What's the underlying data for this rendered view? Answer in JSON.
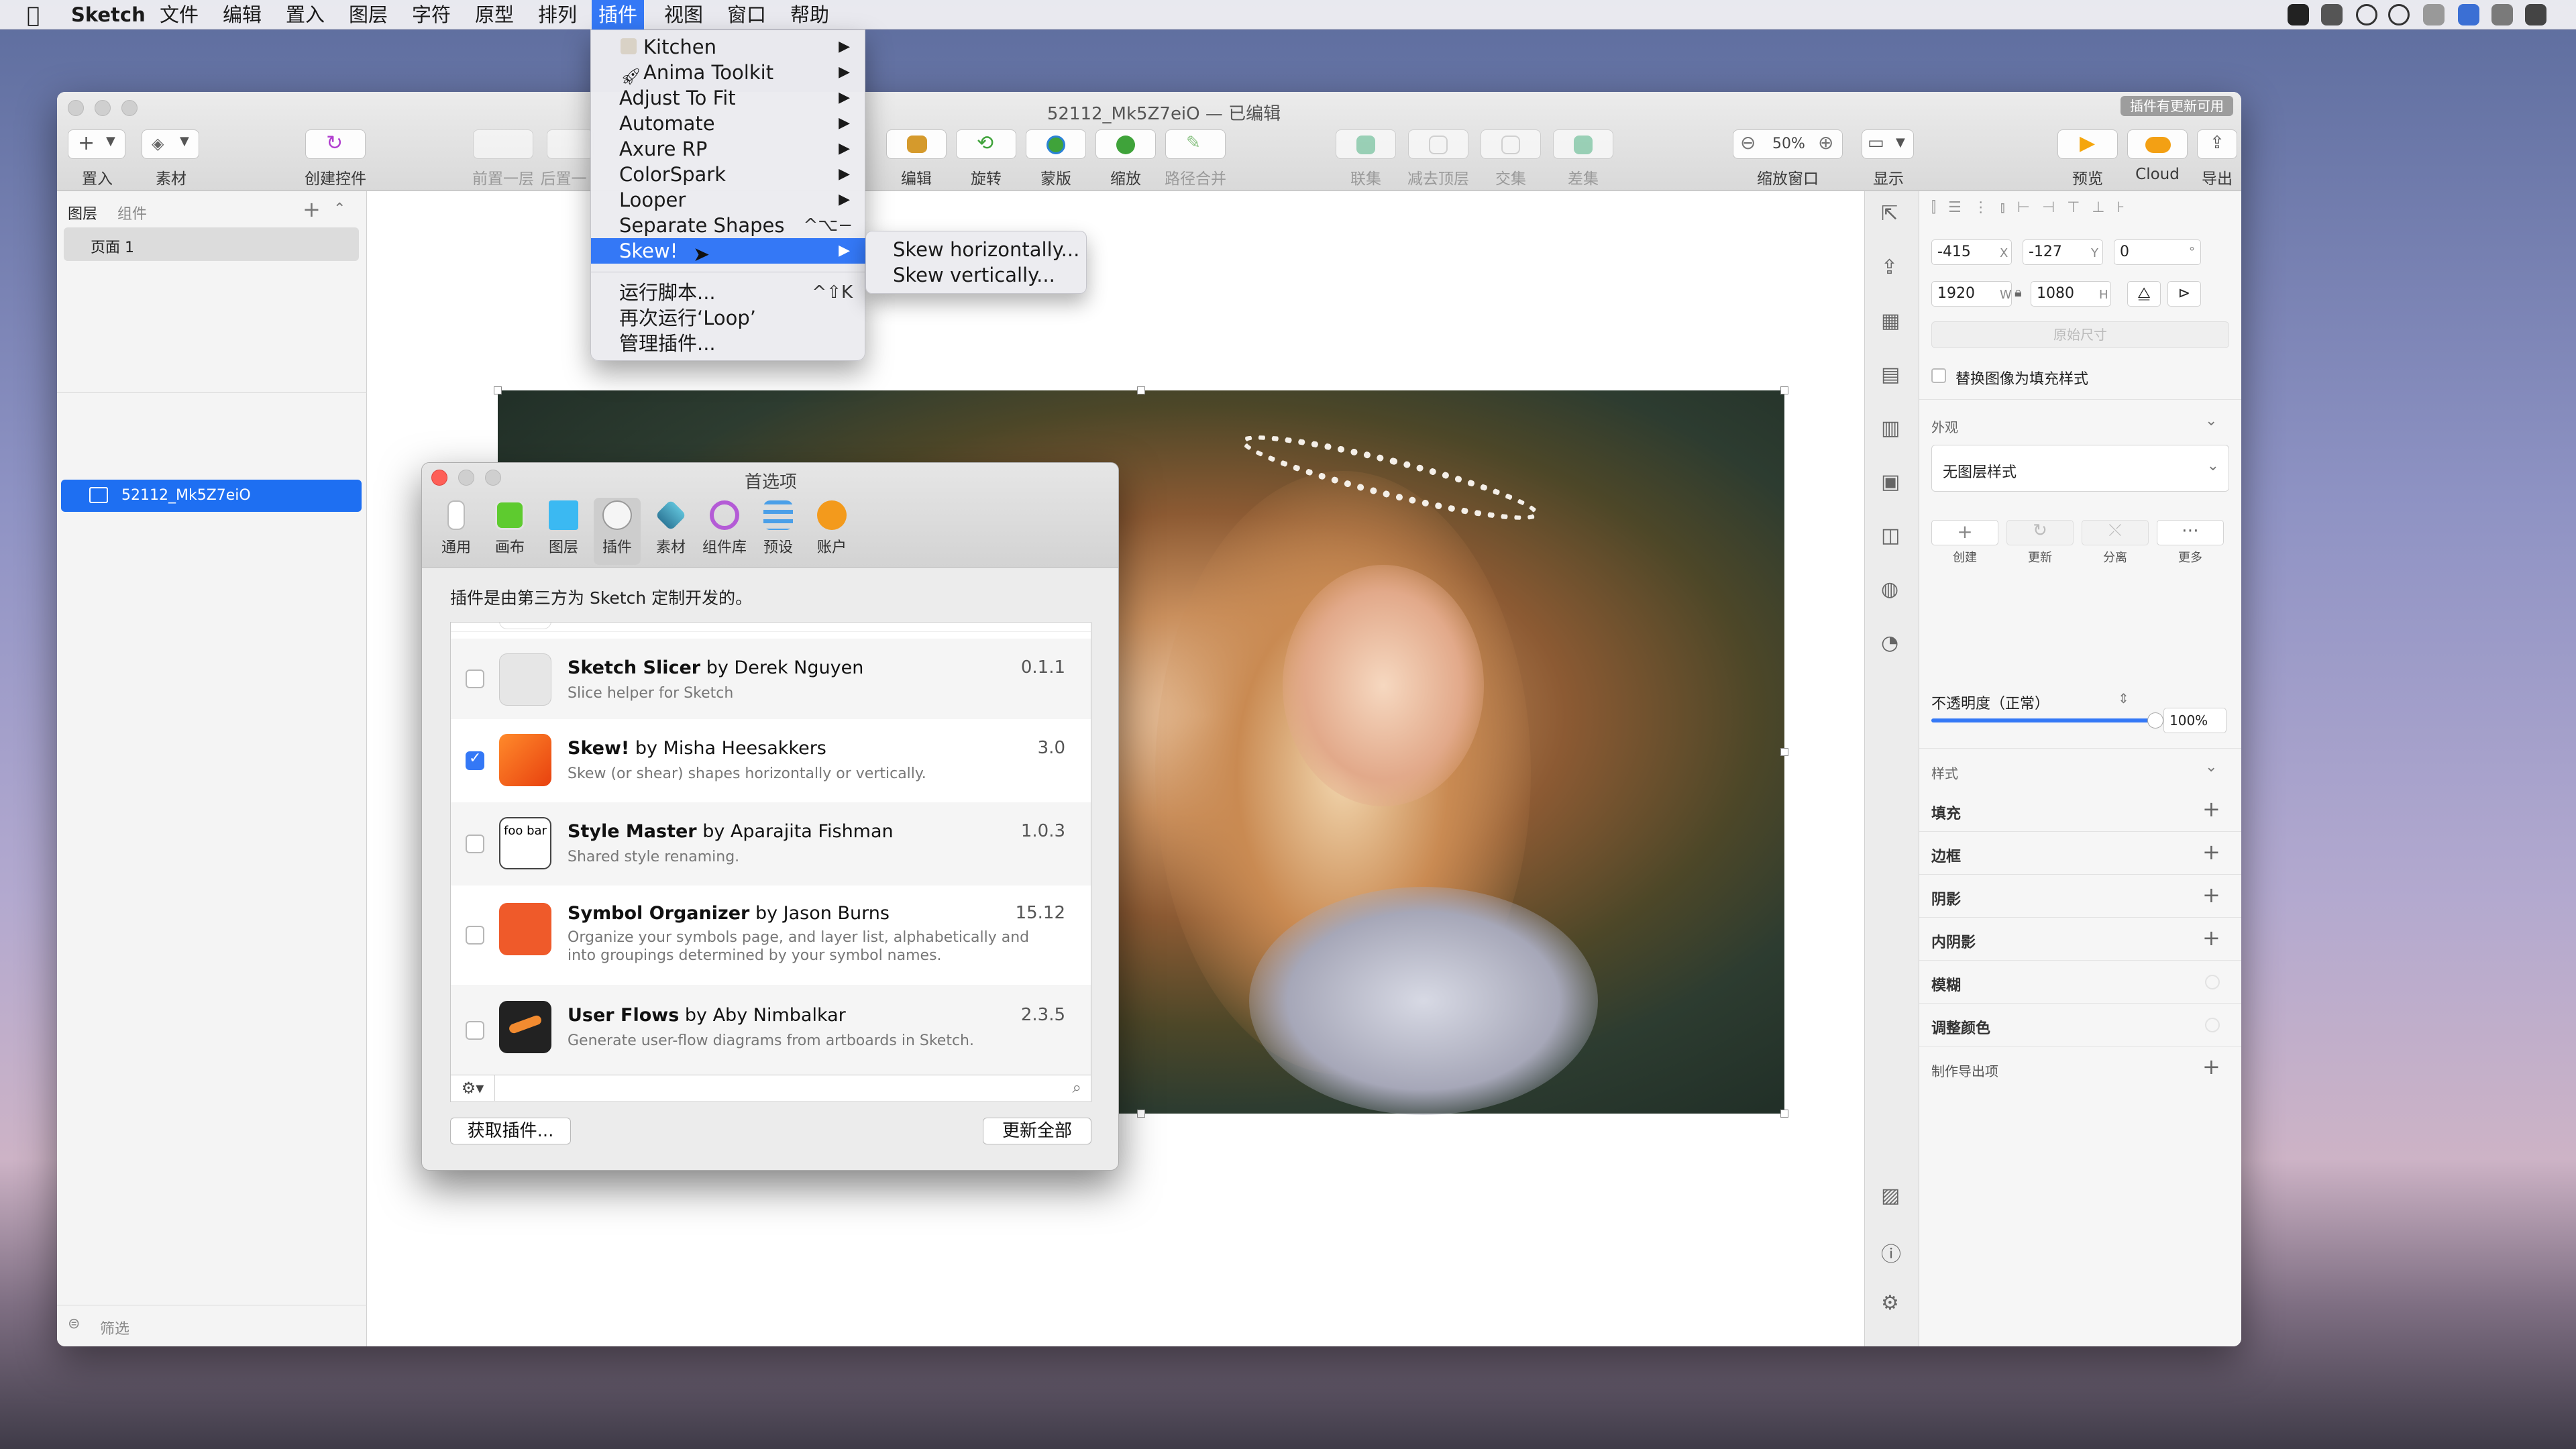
{
  "menubar": {
    "app_name": "Sketch",
    "items": [
      "文件",
      "编辑",
      "置入",
      "图层",
      "字符",
      "原型",
      "排列",
      "插件",
      "视图",
      "窗口",
      "帮助"
    ],
    "selected": "插件"
  },
  "window": {
    "title": "52112_Mk5Z7eiO — 已编辑",
    "update_badge": "插件有更新可用"
  },
  "toolbar": {
    "insert": "置入",
    "assets": "素材",
    "create_symbol": "创建控件",
    "forward": "前置一层",
    "backward": "后置一",
    "edit": "编辑",
    "rotate": "旋转",
    "mask": "蒙版",
    "scale": "缩放",
    "flatten": "路径合并",
    "union": "联集",
    "subtract": "减去顶层",
    "intersect": "交集",
    "difference": "差集",
    "zoom_value": "50%",
    "zoom_label": "缩放窗口",
    "display": "显示",
    "preview": "预览",
    "cloud": "Cloud",
    "export": "导出"
  },
  "sidebar": {
    "tab_layers": "图层",
    "tab_components": "组件",
    "page": "页面 1",
    "layer": "52112_Mk5Z7eiO",
    "filter": "筛选"
  },
  "plugin_menu": {
    "items": [
      {
        "label": "Kitchen",
        "submenu": true
      },
      {
        "label": "Anima Toolkit",
        "submenu": true
      },
      {
        "label": "Adjust To Fit",
        "submenu": true
      },
      {
        "label": "Automate",
        "submenu": true
      },
      {
        "label": "Axure RP",
        "submenu": true
      },
      {
        "label": "ColorSpark",
        "submenu": true
      },
      {
        "label": "Looper",
        "submenu": true
      },
      {
        "label": "Separate Shapes",
        "shortcut": "^⌥−"
      },
      {
        "label": "Skew!",
        "submenu": true,
        "highlighted": true
      }
    ],
    "run_script": "运行脚本...",
    "run_script_shortcut": "^⇧K",
    "rerun": "再次运行‘Loop’",
    "manage": "管理插件..."
  },
  "skew_submenu": {
    "horizontal": "Skew horizontally...",
    "vertical": "Skew vertically..."
  },
  "prefs": {
    "title": "首选项",
    "tabs": [
      "通用",
      "画布",
      "图层",
      "插件",
      "素材",
      "组件库",
      "预设",
      "账户"
    ],
    "active_tab": "插件",
    "note": "插件是由第三方为 Sketch 定制开发的。",
    "plugins": [
      {
        "name": "Sketch Slicer",
        "by": "by Derek Nguyen",
        "desc": "Slice helper for Sketch",
        "version": "0.1.1",
        "enabled": false,
        "color": "#e6e6e6"
      },
      {
        "name": "Skew!",
        "by": "by Misha Heesakkers",
        "desc": "Skew (or shear) shapes horizontally or vertically.",
        "version": "3.0",
        "enabled": true,
        "color": "#f25a1e"
      },
      {
        "name": "Style Master",
        "by": "by Aparajita Fishman",
        "desc": "Shared style renaming.",
        "version": "1.0.3",
        "enabled": false,
        "color": "#ffffff"
      },
      {
        "name": "Symbol Organizer",
        "by": "by Jason Burns",
        "desc": "Organize your symbols page, and layer list, alphabetically and into groupings determined by your symbol names.",
        "version": "15.12",
        "enabled": false,
        "color": "#ef5a2a"
      },
      {
        "name": "User Flows",
        "by": "by Aby Nimbalkar",
        "desc": "Generate user-flow diagrams from artboards in Sketch.",
        "version": "2.3.5",
        "enabled": false,
        "color": "#222222"
      }
    ],
    "style_master_icon_text": "foo bar",
    "get_plugins": "获取插件...",
    "update_all": "更新全部"
  },
  "inspector": {
    "x": "-415",
    "x_suffix": "X",
    "y": "-127",
    "y_suffix": "Y",
    "rotation": "0",
    "rotation_suffix": "°",
    "w": "1920",
    "w_suffix": "W",
    "h": "1080",
    "h_suffix": "H",
    "original_size": "原始尺寸",
    "replace_fill": "替换图像为填充样式",
    "appearance": "外观",
    "layer_style": "无图层样式",
    "style_actions": [
      "创建",
      "更新",
      "分离",
      "更多"
    ],
    "opacity_label": "不透明度（正常）",
    "opacity_value": "100%",
    "opacity": 1.0,
    "style_section": "样式",
    "sections": [
      "填充",
      "边框",
      "阴影",
      "内阴影",
      "模糊",
      "调整颜色"
    ],
    "export": "制作导出项"
  },
  "colors": {
    "accent": "#3478f6",
    "selection": "#1e6ff2"
  }
}
